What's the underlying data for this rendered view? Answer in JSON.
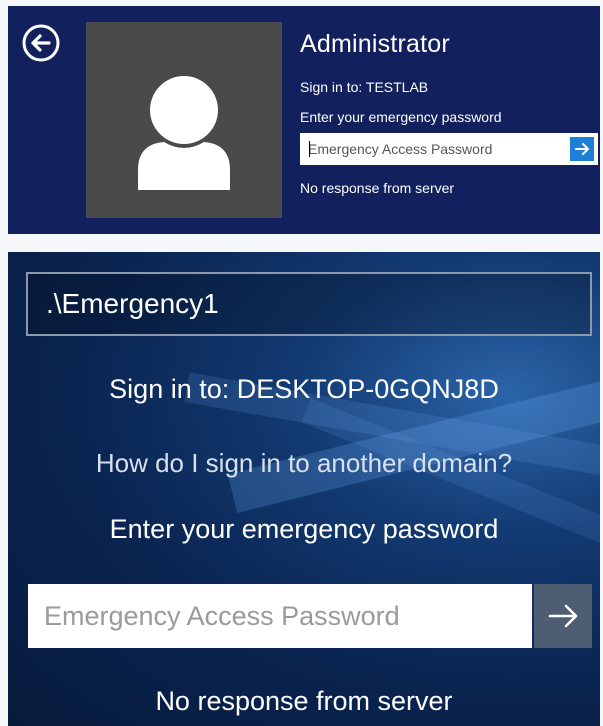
{
  "top_panel": {
    "back_icon": "circled-back-arrow-icon",
    "avatar_icon": "user-silhouette-icon",
    "username": "Administrator",
    "sign_in_to": "Sign in to: TESTLAB",
    "prompt": "Enter your emergency password",
    "password_placeholder": "Emergency Access Password",
    "submit_icon": "arrow-right-icon",
    "status": "No response from server",
    "colors": {
      "background": "#12215e",
      "avatar_tile": "#4a4a4a",
      "submit": "#1e7fd6"
    }
  },
  "bottom_panel": {
    "username_value": ".\\Emergency1",
    "sign_in_to": "Sign in to: DESKTOP-0GQNJ8D",
    "other_domain_link": "How do I sign in to another domain?",
    "prompt": "Enter your emergency password",
    "password_placeholder": "Emergency Access Password",
    "submit_icon": "arrow-right-icon",
    "status": "No response from server",
    "colors": {
      "background": "#0a2552",
      "submit": "#4e5d72"
    }
  }
}
